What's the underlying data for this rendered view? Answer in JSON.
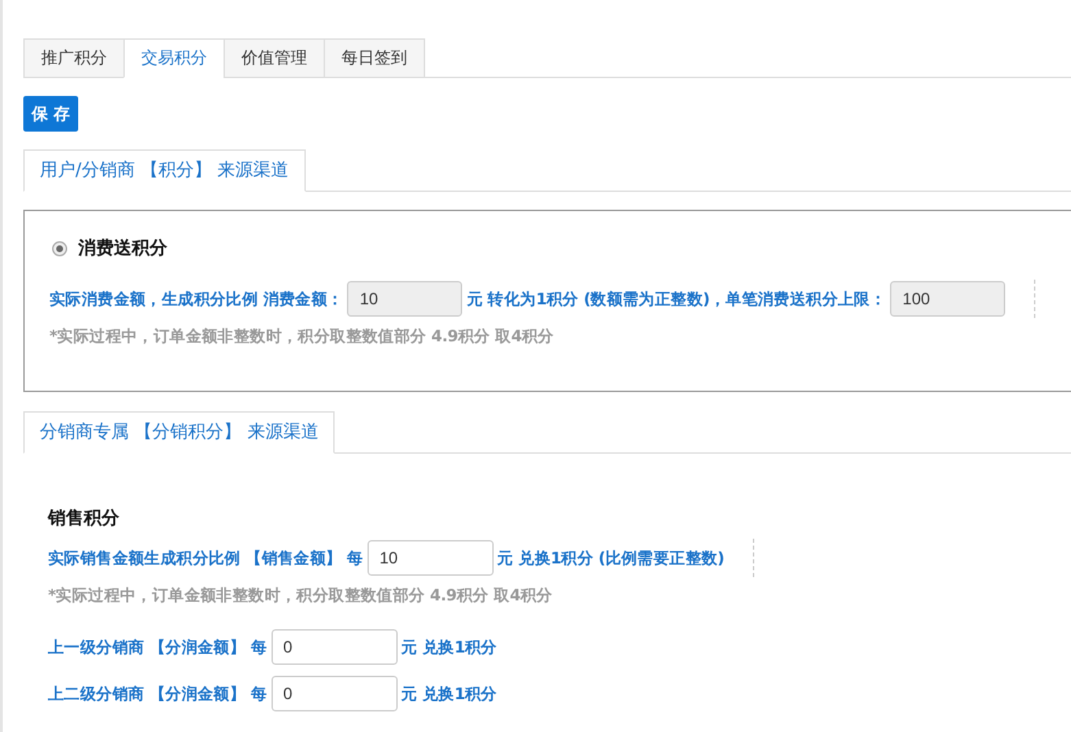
{
  "tabs": [
    {
      "label": "推广积分",
      "selected": false
    },
    {
      "label": "交易积分",
      "selected": true
    },
    {
      "label": "价值管理",
      "selected": false
    },
    {
      "label": "每日签到",
      "selected": false
    }
  ],
  "save_button": "保 存",
  "sections": [
    {
      "title": "用户/分销商 【积分】 来源渠道",
      "boxed": true,
      "option": {
        "label": "消费送积分",
        "selected": true
      },
      "rows": [
        {
          "kind": "fields",
          "separator": true,
          "parts": [
            {
              "kind": "text",
              "text": "实际消费金额，生成积分比例 消费金额："
            },
            {
              "kind": "input",
              "value": "10",
              "disabled": true
            },
            {
              "kind": "text",
              "text": "元 转化为1积分 (数额需为正整数)，单笔消费送积分上限："
            },
            {
              "kind": "input",
              "value": "100",
              "disabled": true
            }
          ]
        },
        {
          "kind": "note",
          "text": "*实际过程中，订单金额非整数时，积分取整数值部分 4.9积分 取4积分"
        }
      ]
    },
    {
      "title": "分销商专属 【分销积分】 来源渠道",
      "boxed": false,
      "heading": "销售积分",
      "rows": [
        {
          "kind": "fields",
          "separator": true,
          "parts": [
            {
              "kind": "text",
              "text": "实际销售金额生成积分比例 【销售金额】 每"
            },
            {
              "kind": "input",
              "value": "10",
              "disabled": false
            },
            {
              "kind": "text",
              "text": "元 兑换1积分 (比例需要正整数)"
            }
          ]
        },
        {
          "kind": "note",
          "text": "*实际过程中，订单金额非整数时，积分取整数值部分 4.9积分 取4积分"
        },
        {
          "kind": "fields",
          "separator": false,
          "parts": [
            {
              "kind": "text",
              "text": "上一级分销商 【分润金额】 每"
            },
            {
              "kind": "input",
              "value": "0",
              "disabled": false
            },
            {
              "kind": "text",
              "text": "元 兑换1积分"
            }
          ]
        },
        {
          "kind": "fields",
          "separator": false,
          "parts": [
            {
              "kind": "text",
              "text": "上二级分销商 【分润金额】 每"
            },
            {
              "kind": "input",
              "value": "0",
              "disabled": false
            },
            {
              "kind": "text",
              "text": "元 兑换1积分"
            }
          ]
        }
      ]
    }
  ]
}
